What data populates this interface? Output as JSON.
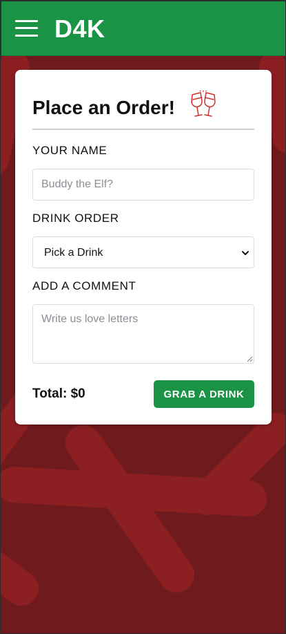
{
  "header": {
    "brand": "D4K",
    "menu_icon": "hamburger-menu-icon",
    "background_color": "#1a9345"
  },
  "page": {
    "background_color": "#6f1a1d"
  },
  "order_form": {
    "title": "Place an Order!",
    "title_icon": "clinking-glasses-icon",
    "name": {
      "label": "YOUR NAME",
      "value": "",
      "placeholder": "Buddy the Elf?"
    },
    "drink": {
      "label": "DRINK ORDER",
      "selected": "Pick a Drink"
    },
    "comment": {
      "label": "ADD A COMMENT",
      "value": "",
      "placeholder": "Write us love letters"
    },
    "total": "Total: $0",
    "submit_label": "GRAB A DRINK",
    "accent_color": "#1a9345",
    "icon_color": "#d0312d"
  }
}
